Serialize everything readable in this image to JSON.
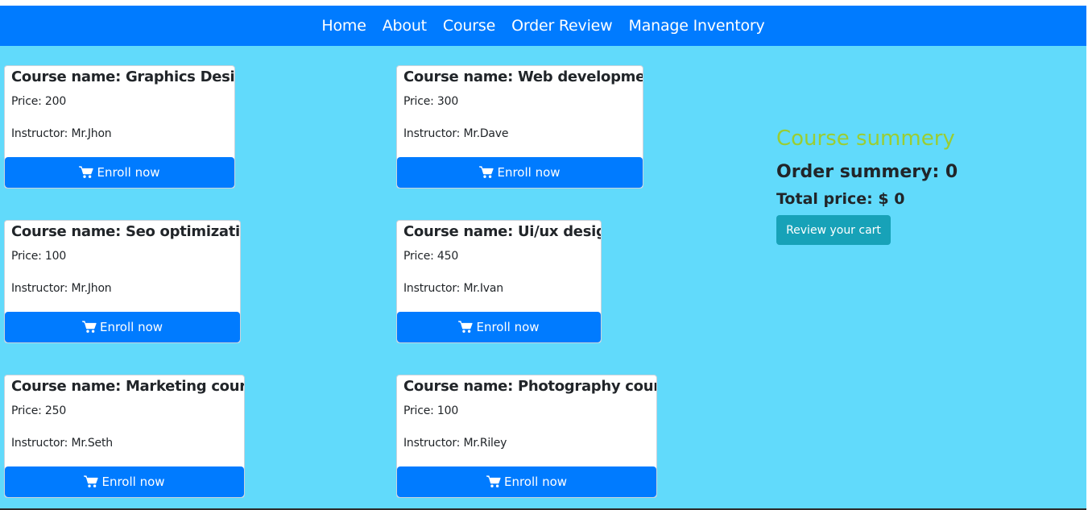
{
  "nav": {
    "items": [
      {
        "label": "Home"
      },
      {
        "label": "About"
      },
      {
        "label": "Course"
      },
      {
        "label": "Order Review"
      },
      {
        "label": "Manage Inventory"
      }
    ]
  },
  "courses": [
    {
      "name": "Course name: Graphics Design",
      "price": "Price: 200",
      "instructor": "Instructor: Mr.Jhon",
      "button": "Enroll now"
    },
    {
      "name": "Course name: Web development",
      "price": "Price: 300",
      "instructor": "Instructor: Mr.Dave",
      "button": "Enroll now"
    },
    {
      "name": "Course name: Seo optimization",
      "price": "Price: 100",
      "instructor": "Instructor: Mr.Jhon",
      "button": "Enroll now"
    },
    {
      "name": "Course name: Ui/ux design",
      "price": "Price: 450",
      "instructor": "Instructor: Mr.Ivan",
      "button": "Enroll now"
    },
    {
      "name": "Course name: Marketing course",
      "price": "Price: 250",
      "instructor": "Instructor: Mr.Seth",
      "button": "Enroll now"
    },
    {
      "name": "Course name: Photography course",
      "price": "Price: 100",
      "instructor": "Instructor: Mr.Riley",
      "button": "Enroll now"
    }
  ],
  "summary": {
    "title": "Course summery",
    "order": "Order summery: 0",
    "total": "Total price: $ 0",
    "review_button": "Review your cart"
  },
  "colors": {
    "navbar": "#007bff",
    "page_background": "#61dafb",
    "summary_title": "#9acd32",
    "review_button": "#17a2b8"
  },
  "icons": {
    "enroll": "cart-icon"
  }
}
